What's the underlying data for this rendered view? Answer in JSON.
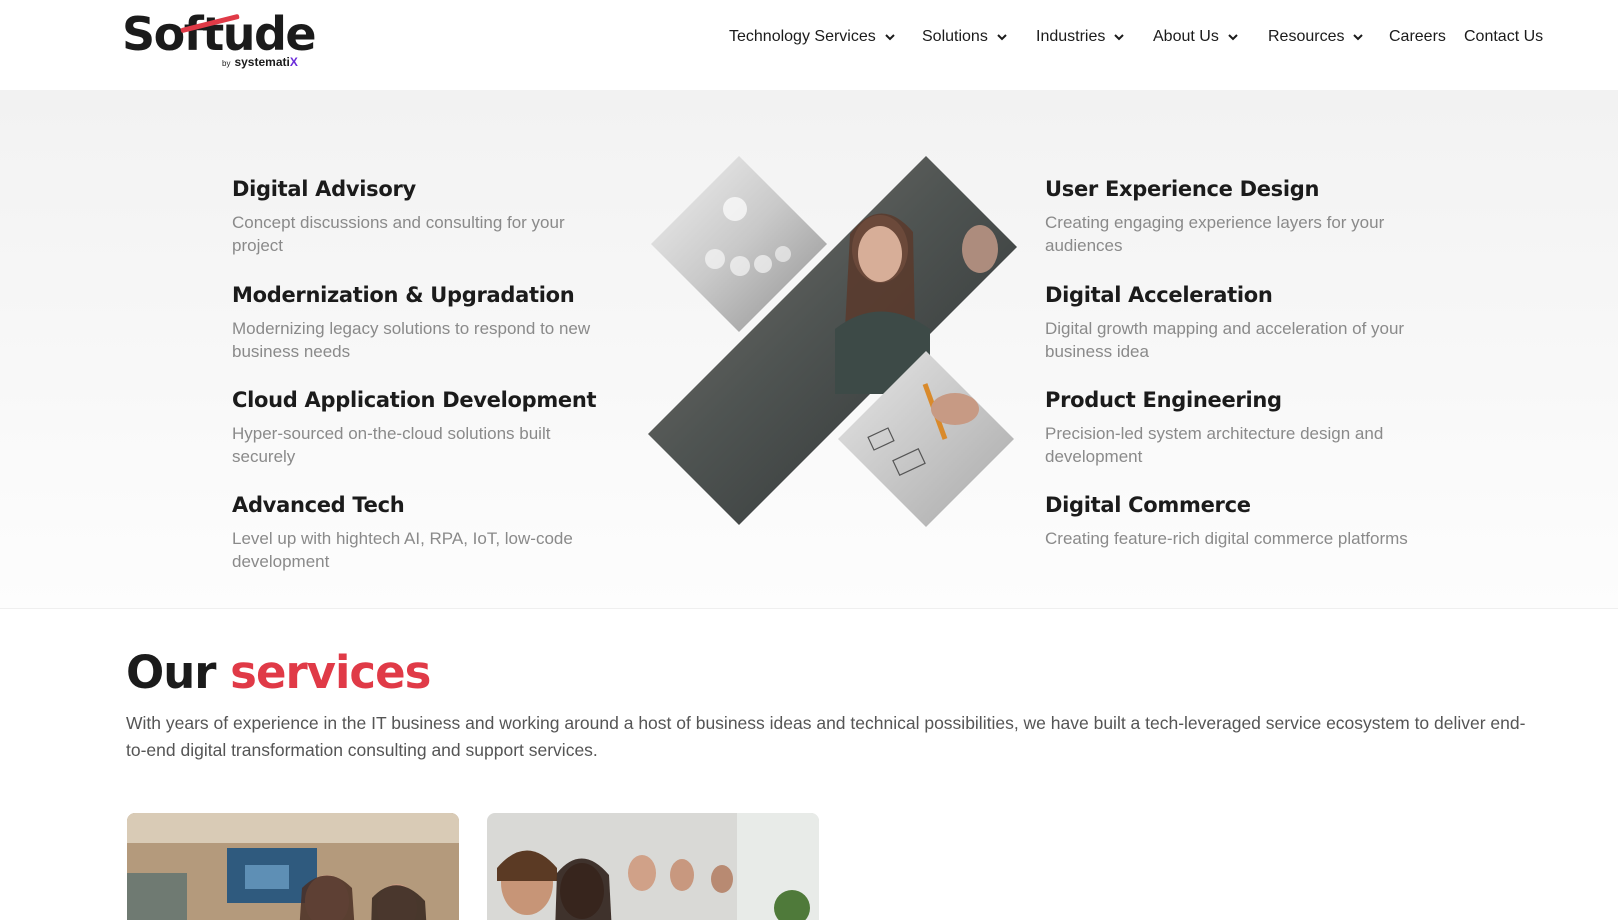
{
  "brand": {
    "logo_text": "Softude",
    "by": "by",
    "company": "systemati",
    "company_x": "X"
  },
  "nav": {
    "technology_services": "Technology Services",
    "solutions": "Solutions",
    "industries": "Industries",
    "about_us": "About Us",
    "resources": "Resources",
    "careers": "Careers",
    "contact_us": "Contact Us"
  },
  "capabilities": {
    "left": [
      {
        "title": "Digital Advisory",
        "desc": "Concept discussions and consulting for your project"
      },
      {
        "title": "Modernization & Upgradation",
        "desc": "Modernizing legacy solutions to respond to new business needs"
      },
      {
        "title": "Cloud Application Development",
        "desc": "Hyper-sourced on-the-cloud solutions built securely"
      },
      {
        "title": "Advanced Tech",
        "desc": "Level up with hightech AI, RPA, IoT, low-code development"
      }
    ],
    "right": [
      {
        "title": "User Experience Design",
        "desc": "Creating engaging experience layers for your audiences"
      },
      {
        "title": "Digital Acceleration",
        "desc": "Digital growth mapping and acceleration of your business idea"
      },
      {
        "title": "Product Engineering",
        "desc": "Precision-led system architecture design and development"
      },
      {
        "title": "Digital Commerce",
        "desc": "Creating feature-rich digital commerce platforms"
      }
    ]
  },
  "services": {
    "title_plain": "Our",
    "title_accent": "services",
    "description": "With years of experience in the IT business and working around a host of business ideas and technical possibilities, we have built a tech-leveraged service ecosystem to deliver end-to-end digital transformation consulting and support services."
  },
  "colors": {
    "accent": "#e03a47",
    "text": "#1b1b1b",
    "muted": "#8a8a8a",
    "band_bg": "#f4f4f4"
  },
  "icons": [
    "chevron-down-icon"
  ]
}
